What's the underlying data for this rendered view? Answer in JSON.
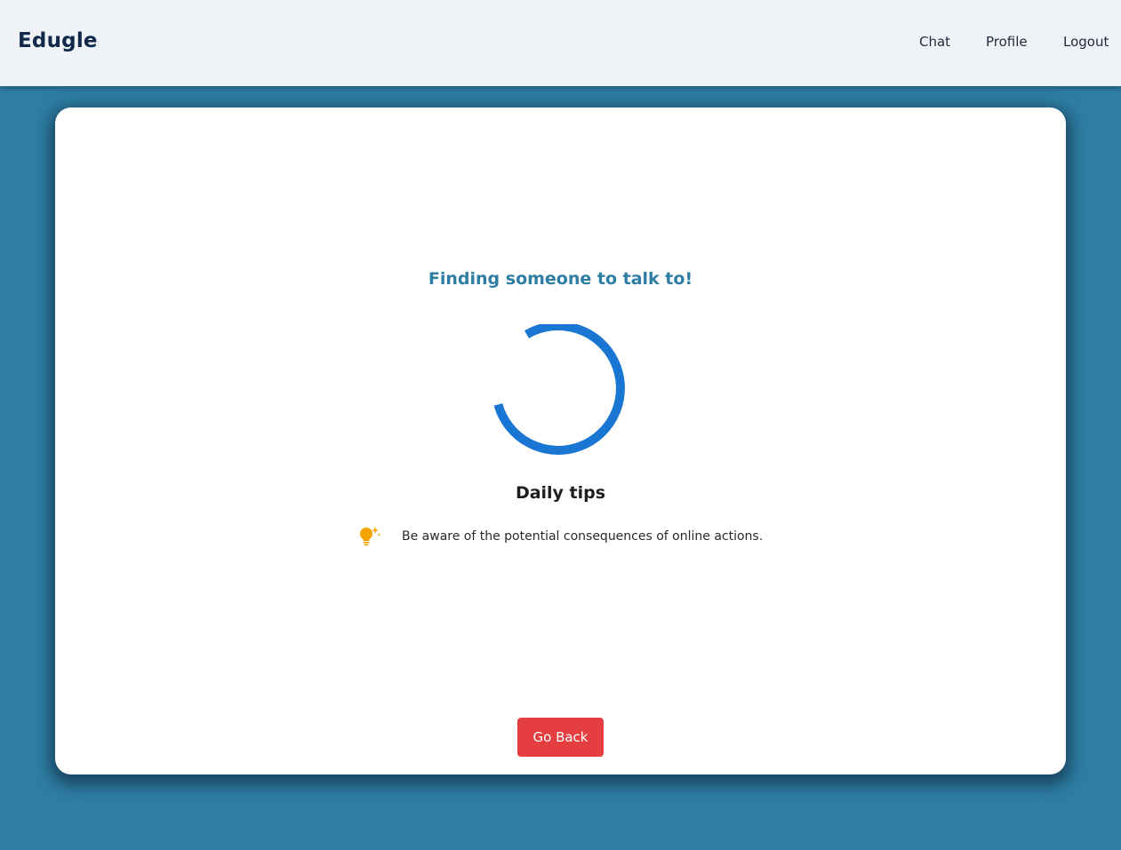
{
  "navbar": {
    "brand": "Edugle",
    "links": {
      "chat": "Chat",
      "profile": "Profile",
      "logout": "Logout"
    }
  },
  "main": {
    "heading": "Finding someone to talk to!",
    "spinner": {
      "icon": "loading-spinner",
      "color": "#1976d2"
    },
    "tips": {
      "title": "Daily tips",
      "icon": "lightbulb-icon",
      "icon_color": "#f5a300",
      "text": "Be aware of the potential consequences of online actions."
    },
    "go_back_label": "Go Back"
  },
  "colors": {
    "background": "#2e7da3",
    "navbar_bg": "#eff3f8",
    "heading": "#2e7da3",
    "button": "#e53e41"
  }
}
